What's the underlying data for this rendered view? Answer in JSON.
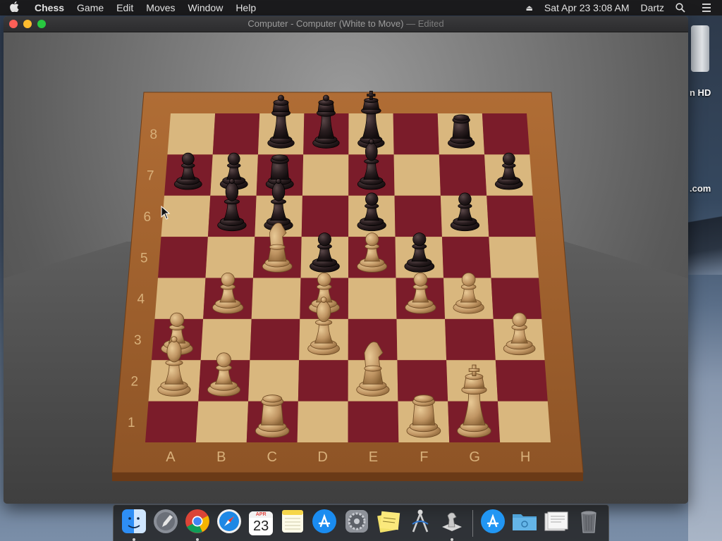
{
  "menubar": {
    "apple": "",
    "menus": [
      "Chess",
      "Game",
      "Edit",
      "Moves",
      "Window",
      "Help"
    ],
    "clock": "Sat Apr 23  3:08 AM",
    "user": "Dartz"
  },
  "window": {
    "title": "Computer - Computer   (White to Move)",
    "edited": " — Edited"
  },
  "board": {
    "files": [
      "A",
      "B",
      "C",
      "D",
      "E",
      "F",
      "G",
      "H"
    ],
    "ranks": [
      "8",
      "7",
      "6",
      "5",
      "4",
      "3",
      "2",
      "1"
    ],
    "colors": {
      "light": "#d9b77e",
      "dark": "#7b1c2a",
      "frame": "#9a5f2e",
      "white_piece": "#c9a06a",
      "black_piece": "#201819"
    },
    "pieces": [
      {
        "side": "black",
        "type": "queen",
        "square": "c8"
      },
      {
        "side": "black",
        "type": "queen",
        "square": "d8"
      },
      {
        "side": "black",
        "type": "king",
        "square": "e8"
      },
      {
        "side": "black",
        "type": "rook",
        "square": "g8"
      },
      {
        "side": "black",
        "type": "pawn",
        "square": "a7"
      },
      {
        "side": "black",
        "type": "pawn",
        "square": "b7"
      },
      {
        "side": "black",
        "type": "rook",
        "square": "c7"
      },
      {
        "side": "black",
        "type": "bishop",
        "square": "e7"
      },
      {
        "side": "black",
        "type": "pawn",
        "square": "h7"
      },
      {
        "side": "black",
        "type": "bishop",
        "square": "b6"
      },
      {
        "side": "black",
        "type": "bishop",
        "square": "c6"
      },
      {
        "side": "black",
        "type": "pawn",
        "square": "e6"
      },
      {
        "side": "black",
        "type": "pawn",
        "square": "g6"
      },
      {
        "side": "black",
        "type": "pawn",
        "square": "d5"
      },
      {
        "side": "black",
        "type": "pawn",
        "square": "f5"
      },
      {
        "side": "white",
        "type": "knight",
        "square": "c5"
      },
      {
        "side": "white",
        "type": "pawn",
        "square": "e5"
      },
      {
        "side": "white",
        "type": "pawn",
        "square": "b4"
      },
      {
        "side": "white",
        "type": "pawn",
        "square": "d4"
      },
      {
        "side": "white",
        "type": "pawn",
        "square": "f4"
      },
      {
        "side": "white",
        "type": "pawn",
        "square": "g4"
      },
      {
        "side": "white",
        "type": "pawn",
        "square": "a3"
      },
      {
        "side": "white",
        "type": "bishop",
        "square": "d3"
      },
      {
        "side": "white",
        "type": "pawn",
        "square": "h3"
      },
      {
        "side": "white",
        "type": "bishop",
        "square": "a2"
      },
      {
        "side": "white",
        "type": "pawn",
        "square": "b2"
      },
      {
        "side": "white",
        "type": "knight",
        "square": "e2"
      },
      {
        "side": "white",
        "type": "rook",
        "square": "c1"
      },
      {
        "side": "white",
        "type": "rook",
        "square": "f1"
      },
      {
        "side": "white",
        "type": "king",
        "square": "g1"
      }
    ]
  },
  "desktop": {
    "disk_label": "n HD",
    "file_label": ".com"
  },
  "dock": {
    "items": [
      {
        "name": "finder-icon",
        "running": true
      },
      {
        "name": "launchpad-icon",
        "running": false
      },
      {
        "name": "chrome-icon",
        "running": true
      },
      {
        "name": "safari-icon",
        "running": false
      },
      {
        "name": "calendar-icon",
        "running": false,
        "month": "APR",
        "day": "23"
      },
      {
        "name": "notes-icon",
        "running": false
      },
      {
        "name": "app-store-icon",
        "running": false
      },
      {
        "name": "system-preferences-icon",
        "running": false
      },
      {
        "name": "stickies-icon",
        "running": false
      },
      {
        "name": "instruments-icon",
        "running": false
      },
      {
        "name": "chess-icon",
        "running": true
      },
      {
        "name": "app-store-download-icon",
        "running": false
      },
      {
        "name": "folder-icon",
        "running": false
      },
      {
        "name": "document-stack-icon",
        "running": false
      },
      {
        "name": "trash-icon",
        "running": false
      }
    ]
  }
}
